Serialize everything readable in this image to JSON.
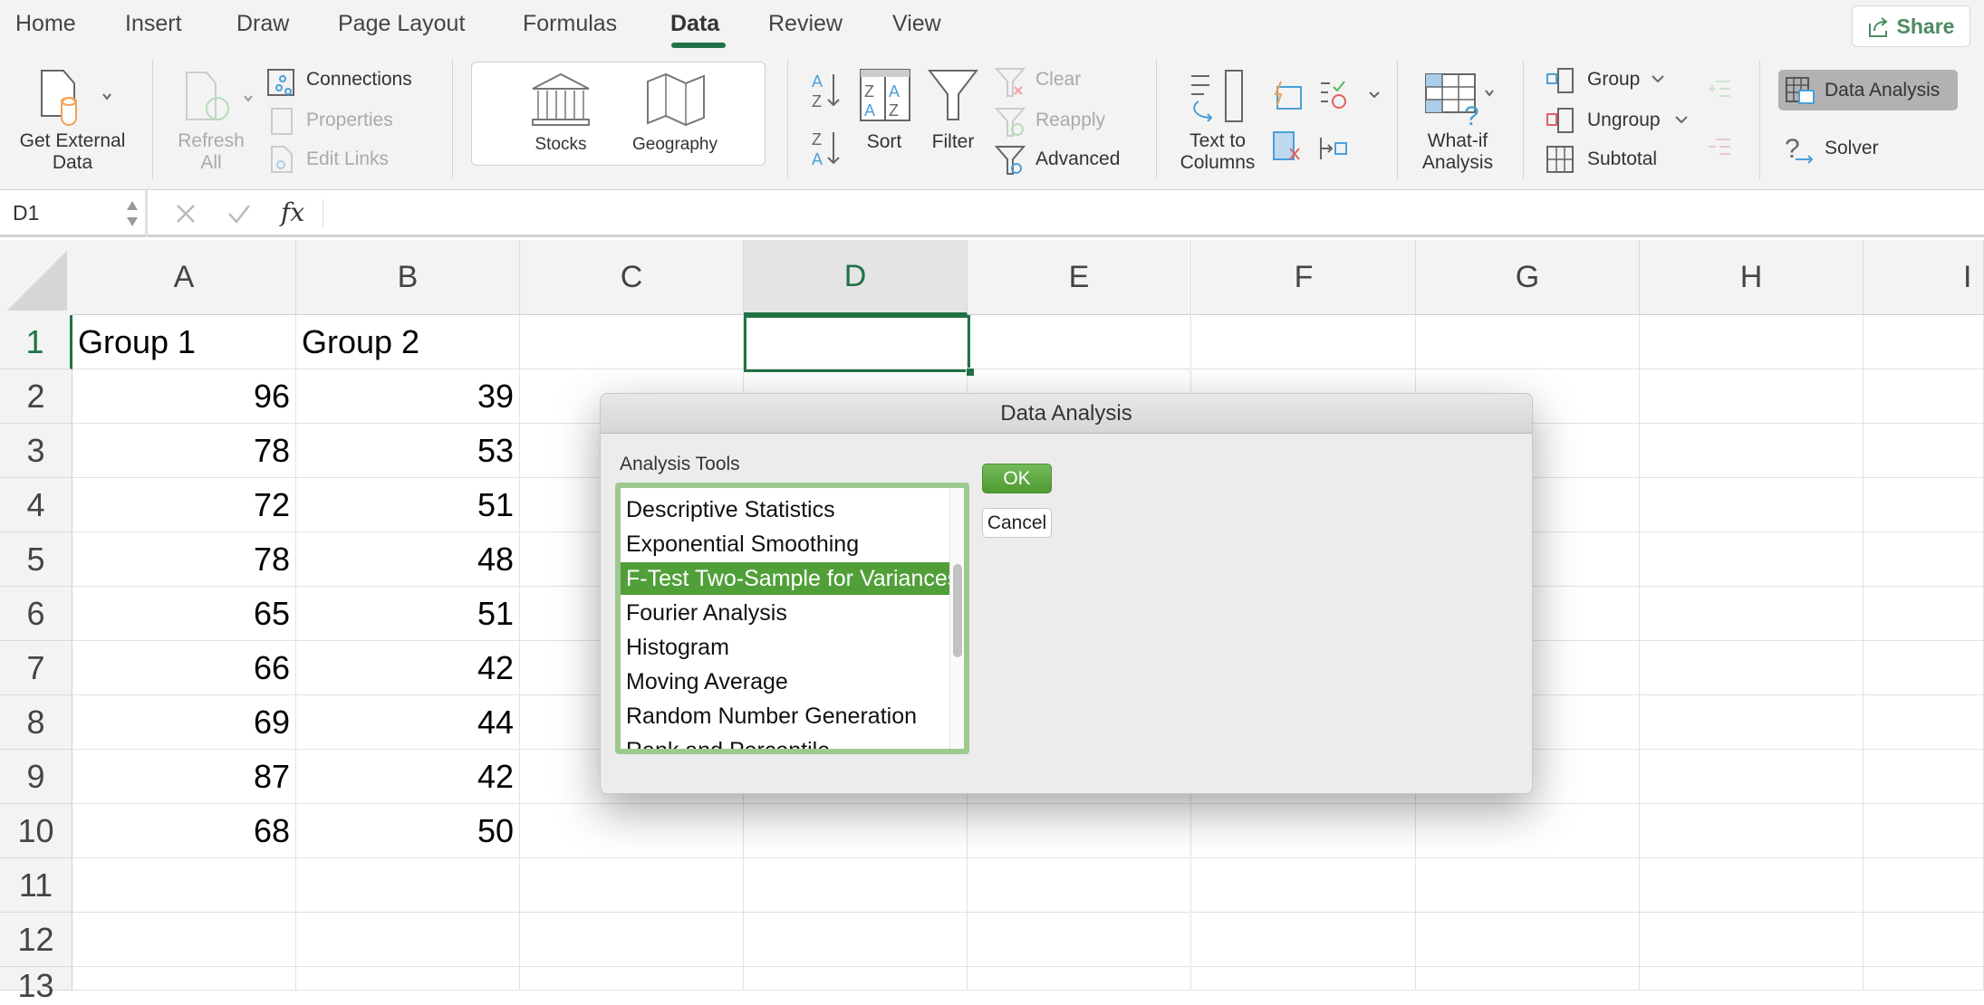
{
  "tabs": [
    {
      "label": "Home"
    },
    {
      "label": "Insert"
    },
    {
      "label": "Draw"
    },
    {
      "label": "Page Layout"
    },
    {
      "label": "Formulas"
    },
    {
      "label": "Data",
      "active": true
    },
    {
      "label": "Review"
    },
    {
      "label": "View"
    }
  ],
  "share_label": "Share",
  "ribbon": {
    "get_external_data": [
      "Get External",
      "Data"
    ],
    "refresh_all": [
      "Refresh",
      "All"
    ],
    "connections": "Connections",
    "properties": "Properties",
    "edit_links": "Edit Links",
    "stocks": "Stocks",
    "geography": "Geography",
    "sort": "Sort",
    "filter": "Filter",
    "clear": "Clear",
    "reapply": "Reapply",
    "advanced": "Advanced",
    "text_to_columns": [
      "Text to",
      "Columns"
    ],
    "what_if": [
      "What-if",
      "Analysis"
    ],
    "group": "Group",
    "ungroup": "Ungroup",
    "subtotal": "Subtotal",
    "data_analysis": "Data Analysis",
    "solver": "Solver"
  },
  "formula_bar": {
    "name_box": "D1",
    "fx": "fx",
    "value": ""
  },
  "grid": {
    "columns": [
      "A",
      "B",
      "C",
      "D",
      "E",
      "F",
      "G",
      "H",
      "I"
    ],
    "selected_cell": "D1",
    "rows": [
      [
        "Group 1",
        "Group 2"
      ],
      [
        96,
        39
      ],
      [
        78,
        53
      ],
      [
        72,
        51
      ],
      [
        78,
        48
      ],
      [
        65,
        51
      ],
      [
        66,
        42
      ],
      [
        69,
        44
      ],
      [
        87,
        42
      ],
      [
        68,
        50
      ],
      [],
      [],
      []
    ]
  },
  "dialog": {
    "title": "Data Analysis",
    "list_label": "Analysis Tools",
    "items": [
      "Descriptive Statistics",
      "Exponential Smoothing",
      "F-Test Two-Sample for Variances",
      "Fourier Analysis",
      "Histogram",
      "Moving Average",
      "Random Number Generation",
      "Rank and Percentile"
    ],
    "selected": "F-Test Two-Sample for Variances",
    "ok": "OK",
    "cancel": "Cancel"
  },
  "colors": {
    "accent": "#217346",
    "selection": "#519f39",
    "listbox_border": "#9dc98f"
  }
}
